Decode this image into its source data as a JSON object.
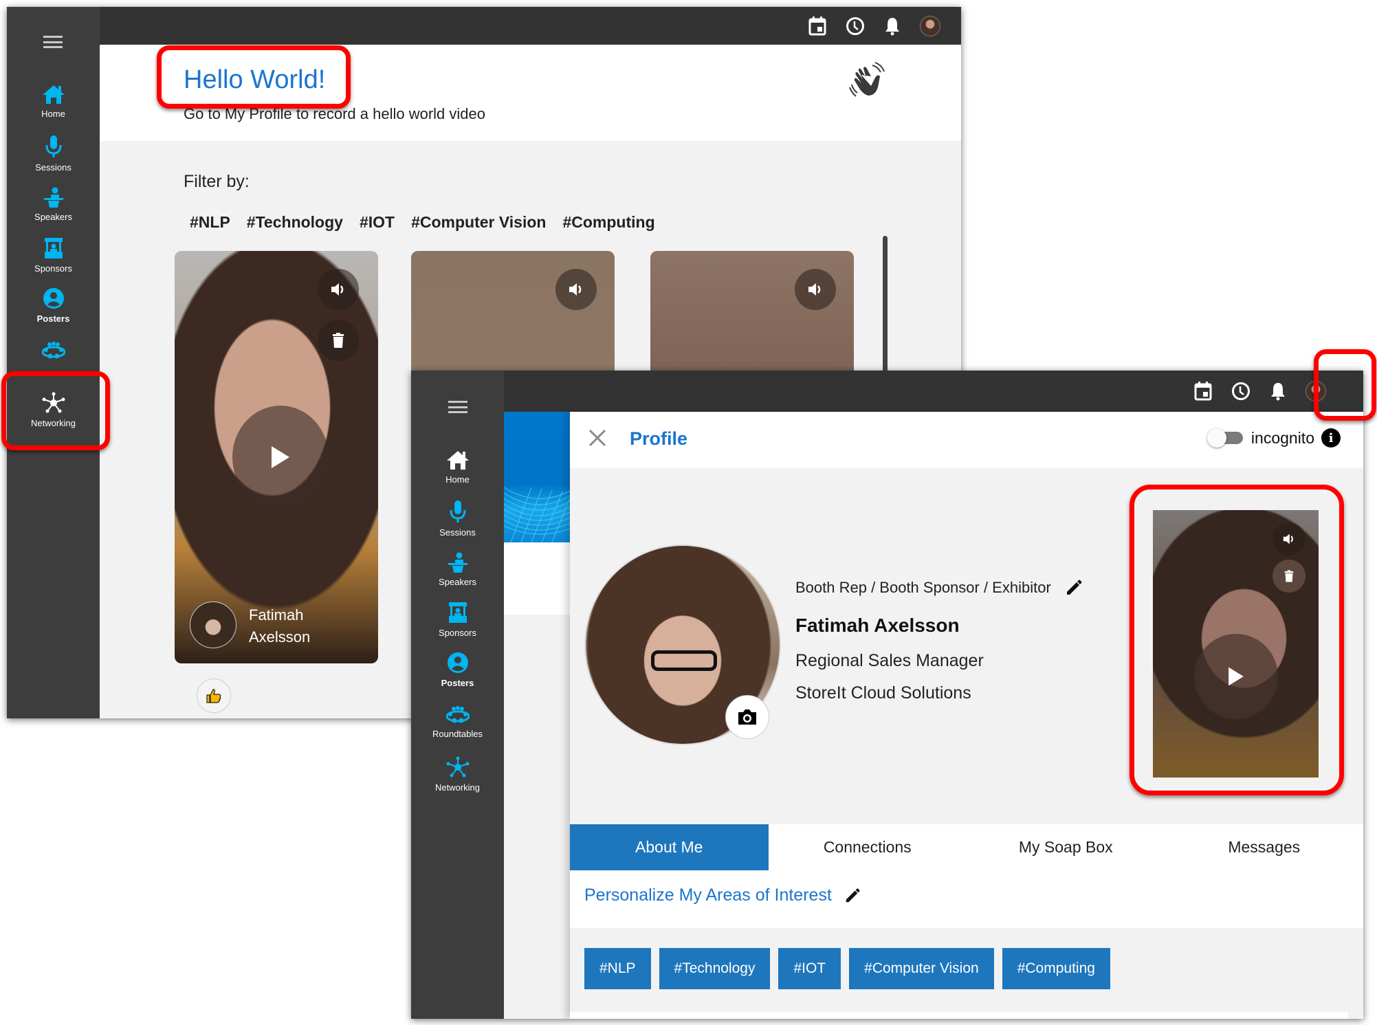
{
  "colors": {
    "accent_blue": "#1a75cf",
    "tag_blue": "#1e76bd",
    "nav_icon_cyan": "#00b5f0",
    "sidebar_bg": "#3d3d3d",
    "topbar_bg": "#333333",
    "highlight_red": "#ff0000"
  },
  "back_window": {
    "sidebar": {
      "menu_icon": "hamburger-icon",
      "items": [
        {
          "label": "Home",
          "icon": "home-icon"
        },
        {
          "label": "Sessions",
          "icon": "microphone-icon"
        },
        {
          "label": "Speakers",
          "icon": "podium-icon"
        },
        {
          "label": "Sponsors",
          "icon": "booth-icon"
        },
        {
          "label": "Posters",
          "icon": "user-circle-icon",
          "active": true
        },
        {
          "label": "",
          "icon": "group-icon"
        },
        {
          "label": "Networking",
          "icon": "network-icon",
          "highlighted": true
        }
      ]
    },
    "topbar": {
      "icons": [
        "calendar-icon",
        "clock-icon",
        "bell-icon",
        "user-avatar"
      ]
    },
    "hello": {
      "title": "Hello World!",
      "subtitle": "Go to My Profile to record a hello world video",
      "icon": "waving-hand-icon"
    },
    "filter": {
      "label": "Filter by:",
      "tags": [
        "#NLP",
        "#Technology",
        "#IOT",
        "#Computer Vision",
        "#Computing"
      ]
    },
    "videos": [
      {
        "name_line1": "Fatimah",
        "name_line2": "Axelsson",
        "controls": [
          "volume-icon",
          "trash-icon",
          "play-icon"
        ]
      },
      {
        "controls": [
          "volume-icon"
        ]
      },
      {
        "controls": [
          "volume-icon"
        ]
      }
    ],
    "like_icon": "thumbs-up-icon"
  },
  "front_window": {
    "sidebar": {
      "menu_icon": "hamburger-icon",
      "items": [
        {
          "label": "Home",
          "icon": "home-icon"
        },
        {
          "label": "Sessions",
          "icon": "microphone-icon"
        },
        {
          "label": "Speakers",
          "icon": "podium-icon"
        },
        {
          "label": "Sponsors",
          "icon": "booth-icon"
        },
        {
          "label": "Posters",
          "icon": "user-circle-icon",
          "active": true
        },
        {
          "label": "Roundtables",
          "icon": "group-icon"
        },
        {
          "label": "Networking",
          "icon": "network-icon"
        }
      ]
    },
    "topbar": {
      "icons": [
        "calendar-icon",
        "clock-icon",
        "bell-icon",
        "user-avatar"
      ]
    },
    "profile": {
      "title": "Profile",
      "incognito_label": "incognito",
      "incognito_on": false,
      "role": "Booth Rep / Booth Sponsor / Exhibitor",
      "name": "Fatimah Axelsson",
      "job_title": "Regional Sales Manager",
      "company": "StoreIt Cloud Solutions",
      "tabs": [
        {
          "label": "About Me",
          "active": true
        },
        {
          "label": "Connections"
        },
        {
          "label": "My Soap Box"
        },
        {
          "label": "Messages"
        }
      ],
      "interests_title": "Personalize My Areas of Interest",
      "interest_tags": [
        "#NLP",
        "#Technology",
        "#IOT",
        "#Computer Vision",
        "#Computing"
      ]
    }
  }
}
